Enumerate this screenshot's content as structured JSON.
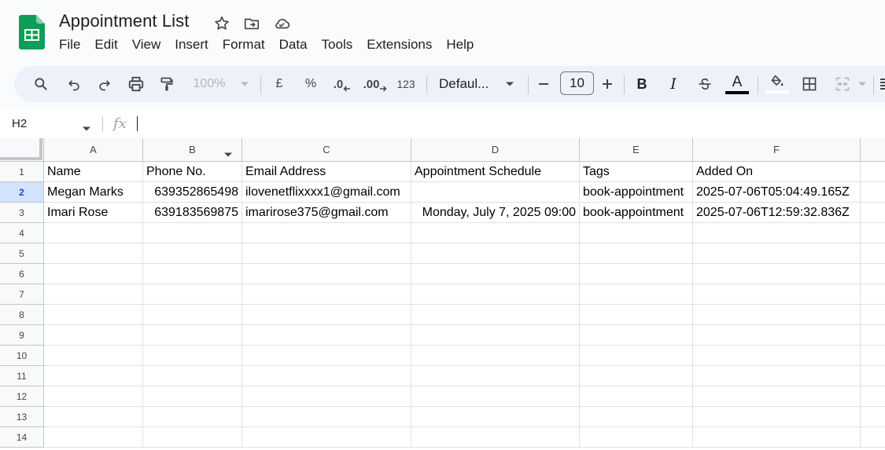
{
  "doc": {
    "title": "Appointment List",
    "brand_color": "#0f9d58"
  },
  "menu": [
    "File",
    "Edit",
    "View",
    "Insert",
    "Format",
    "Data",
    "Tools",
    "Extensions",
    "Help"
  ],
  "toolbar": {
    "zoom": "100%",
    "currency": "£",
    "percent": "%",
    "decrease_decimal": ".0",
    "increase_decimal": ".00",
    "number_format": "123",
    "font_family": "Defaul...",
    "font_size": "10",
    "bold": "B",
    "italic": "I",
    "text_color_letter": "A"
  },
  "formula_bar": {
    "cell_ref": "H2",
    "fx": "fx",
    "value": ""
  },
  "sheet": {
    "columns": [
      "A",
      "B",
      "C",
      "D",
      "E",
      "F"
    ],
    "row_numbers": [
      "1",
      "2",
      "3",
      "4",
      "5",
      "6",
      "7",
      "8",
      "9",
      "10",
      "11",
      "12",
      "13",
      "14"
    ],
    "active_row": "2",
    "rows": [
      [
        "Name",
        "Phone No.",
        "Email Address",
        "Appointment Schedule",
        "Tags",
        "Added On"
      ],
      [
        "Megan Marks",
        "639352865498",
        "ilovenetflixxxx1@gmail.com",
        "",
        "book-appointment",
        "2025-07-06T05:04:49.165Z"
      ],
      [
        "Imari Rose",
        "639183569875",
        "imarirose375@gmail.com",
        "Monday, July 7, 2025 09:00",
        "book-appointment",
        "2025-07-06T12:59:32.836Z"
      ]
    ]
  }
}
